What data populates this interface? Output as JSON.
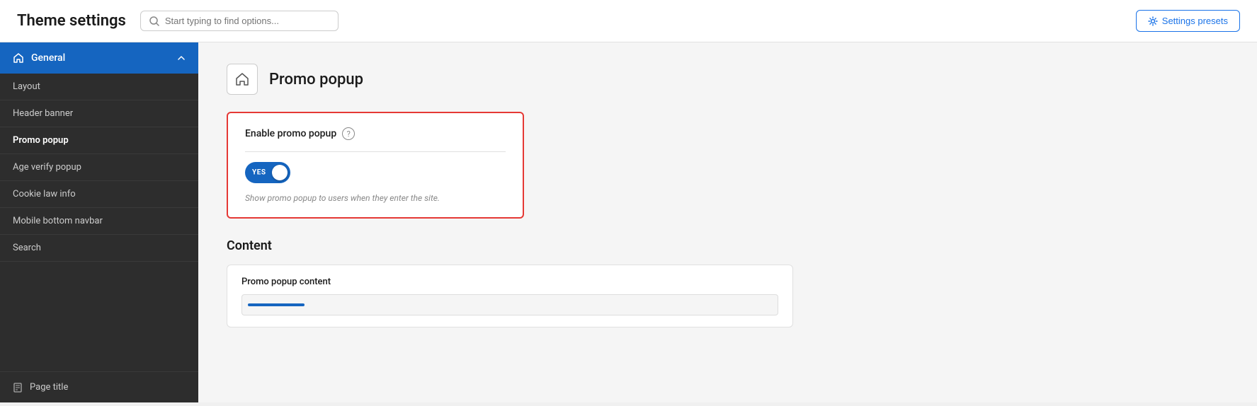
{
  "header": {
    "title": "Theme settings",
    "search_placeholder": "Start typing to find options...",
    "settings_presets_label": "Settings presets"
  },
  "sidebar": {
    "general_label": "General",
    "items": [
      {
        "label": "Layout",
        "active": false
      },
      {
        "label": "Header banner",
        "active": false
      },
      {
        "label": "Promo popup",
        "active": true
      },
      {
        "label": "Age verify popup",
        "active": false
      },
      {
        "label": "Cookie law info",
        "active": false
      },
      {
        "label": "Mobile bottom navbar",
        "active": false
      },
      {
        "label": "Search",
        "active": false
      }
    ],
    "page_title_label": "Page title"
  },
  "content": {
    "section_heading": "Promo popup",
    "enable_popup_label": "Enable promo popup",
    "toggle_yes": "YES",
    "toggle_hint": "Show promo popup to users when they enter the site.",
    "content_section_label": "Content",
    "promo_popup_content_label": "Promo popup content"
  }
}
